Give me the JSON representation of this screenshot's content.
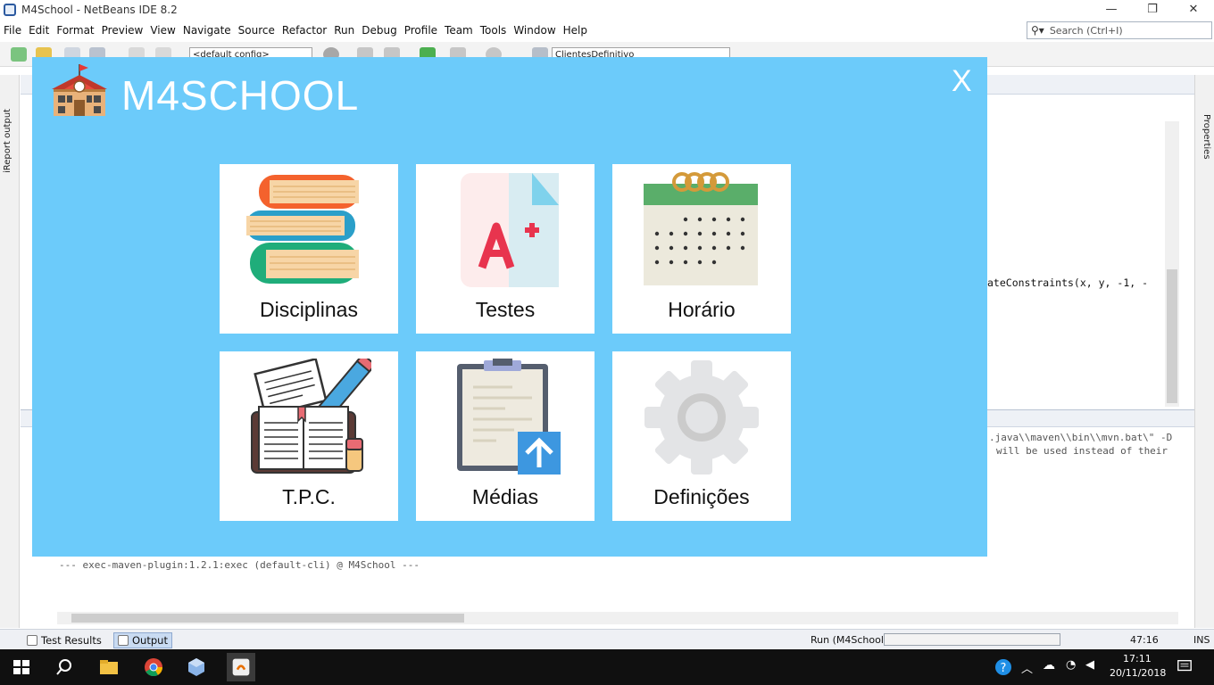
{
  "window": {
    "title": "M4School - NetBeans IDE 8.2",
    "search_placeholder": "Search (Ctrl+I)"
  },
  "menu": [
    "File",
    "Edit",
    "Format",
    "Preview",
    "View",
    "Navigate",
    "Source",
    "Refactor",
    "Run",
    "Debug",
    "Profile",
    "Team",
    "Tools",
    "Window",
    "Help"
  ],
  "toolbar": {
    "config_combo": "<default config>",
    "project_combo": "ClientesDefinitivo"
  },
  "side_panels": {
    "left": "iReport output",
    "right": "Properties"
  },
  "editor": {
    "code_fragment": "ateConstraints(x, y, -1, -"
  },
  "output": {
    "line1": ".java\\\\maven\\\\bin\\\\mvn.bat\\\" -D",
    "line2": "will be used instead of their",
    "line3": "--- exec-maven-plugin:1.2.1:exec (default-cli) @ M4School ---"
  },
  "statusbar": {
    "test_results": "Test Results",
    "output_tab": "Output",
    "run_label": "Run (M4School)",
    "caret": "47:16",
    "mode": "INS"
  },
  "taskbar": {
    "time": "17:11",
    "date": "20/11/2018"
  },
  "app": {
    "title": "M4SCHOOL",
    "close_label": "X",
    "tiles": [
      {
        "label": "Disciplinas",
        "icon": "books-icon"
      },
      {
        "label": "Testes",
        "icon": "test-grade-icon"
      },
      {
        "label": "Horário",
        "icon": "calendar-icon"
      },
      {
        "label": "T.P.C.",
        "icon": "homework-icon"
      },
      {
        "label": "Médias",
        "icon": "clipboard-upload-icon"
      },
      {
        "label": "Definições",
        "icon": "gear-icon"
      }
    ],
    "colors": {
      "background": "#6ccbfa",
      "tile": "#ffffff"
    }
  }
}
